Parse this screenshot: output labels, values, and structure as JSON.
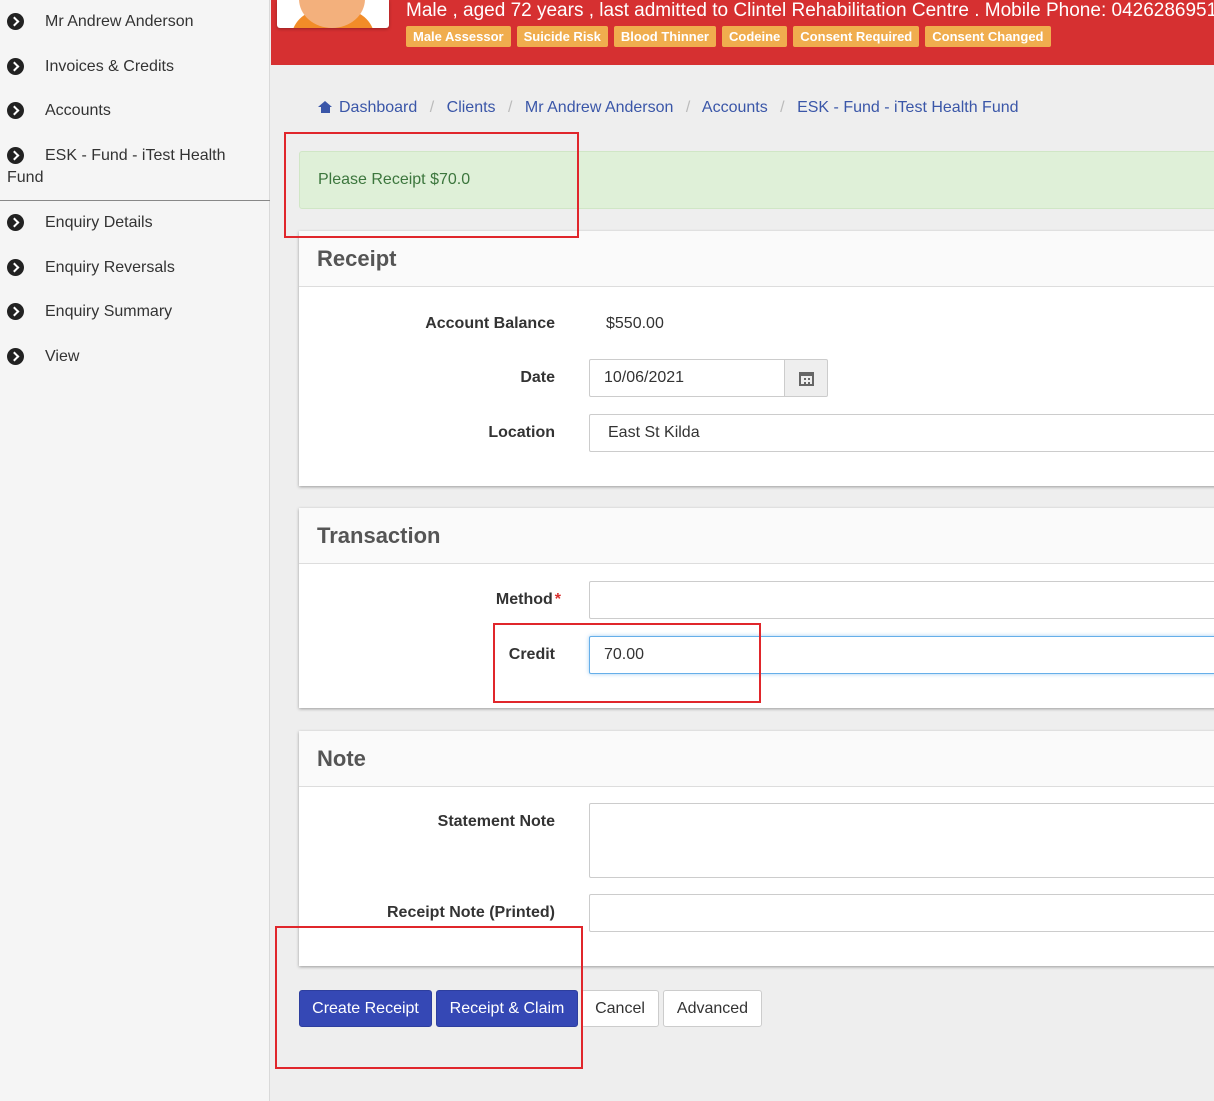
{
  "sidebar": {
    "items": [
      {
        "label": "Mr Andrew Anderson"
      },
      {
        "label": "Invoices & Credits"
      },
      {
        "label": "Accounts"
      },
      {
        "label": "ESK - Fund - iTest Health Fund"
      },
      {
        "label": "Enquiry Details"
      },
      {
        "label": "Enquiry Reversals"
      },
      {
        "label": "Enquiry Summary"
      },
      {
        "label": "View"
      }
    ]
  },
  "header": {
    "patient_info": "Male , aged 72 years , last admitted to Clintel Rehabilitation Centre . Mobile Phone: 0426286951",
    "badges": [
      "Male Assessor",
      "Suicide Risk",
      "Blood Thinner",
      "Codeine",
      "Consent Required",
      "Consent Changed"
    ]
  },
  "breadcrumb": [
    "Dashboard",
    "Clients",
    "Mr Andrew Anderson",
    "Accounts",
    "ESK - Fund - iTest Health Fund"
  ],
  "alert": "Please Receipt $70.0",
  "receipt": {
    "title": "Receipt",
    "account_balance_label": "Account Balance",
    "account_balance": "$550.00",
    "date_label": "Date",
    "date": "10/06/2021",
    "location_label": "Location",
    "location": "East St Kilda"
  },
  "transaction": {
    "title": "Transaction",
    "method_label": "Method",
    "required_mark": "*",
    "method": "",
    "credit_label": "Credit",
    "credit": "70.00"
  },
  "note": {
    "title": "Note",
    "statement_note_label": "Statement Note",
    "statement_note": "",
    "receipt_note_label": "Receipt Note (Printed)",
    "receipt_note": ""
  },
  "buttons": {
    "create_receipt": "Create Receipt",
    "receipt_claim": "Receipt & Claim",
    "cancel": "Cancel",
    "advanced": "Advanced"
  },
  "icons": {
    "sidebar_bullet": "chevron-circle-right-icon",
    "breadcrumb_home": "home-icon",
    "date_picker": "calendar-icon"
  },
  "colors": {
    "header_bg": "#d63031",
    "badge_bg": "#f0ad4e",
    "primary": "#3548b5",
    "link": "#3a56a8",
    "alert_bg": "#dff0d8",
    "annotation": "#e0262b"
  }
}
